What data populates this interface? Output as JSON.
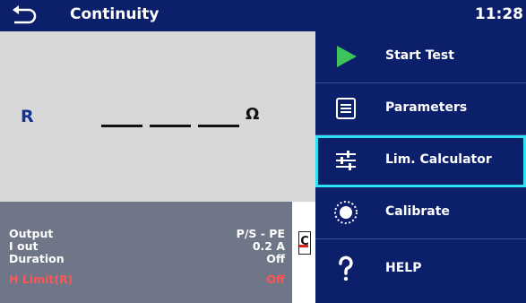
{
  "header": {
    "title": "Continuity",
    "time": "11:28"
  },
  "result": {
    "label": "R",
    "unit": "Ω"
  },
  "parameters": [
    {
      "label": "Output",
      "value": "P/S - PE"
    },
    {
      "label": "I out",
      "value": "0.2 A"
    },
    {
      "label": "Duration",
      "value": "Off"
    },
    {
      "label": "H Limit(R)",
      "value": "Off"
    }
  ],
  "side_stub": {
    "glyph": "C"
  },
  "menu": [
    {
      "label": "Start Test",
      "icon": "play-icon"
    },
    {
      "label": "Parameters",
      "icon": "list-icon"
    },
    {
      "label": "Lim. Calculator",
      "icon": "sliders-icon",
      "selected": true
    },
    {
      "label": "Calibrate",
      "icon": "calibrate-icon"
    },
    {
      "label": "HELP",
      "icon": "help-icon"
    }
  ],
  "colors": {
    "header_bg": "#0b1f6b",
    "menu_bg": "#0b1f6b",
    "selection": "#2fe0f0",
    "play_green": "#3cc35a",
    "limit_red": "#ff5555",
    "result_bg": "#d8d8d8",
    "params_bg": "#6e7688"
  }
}
